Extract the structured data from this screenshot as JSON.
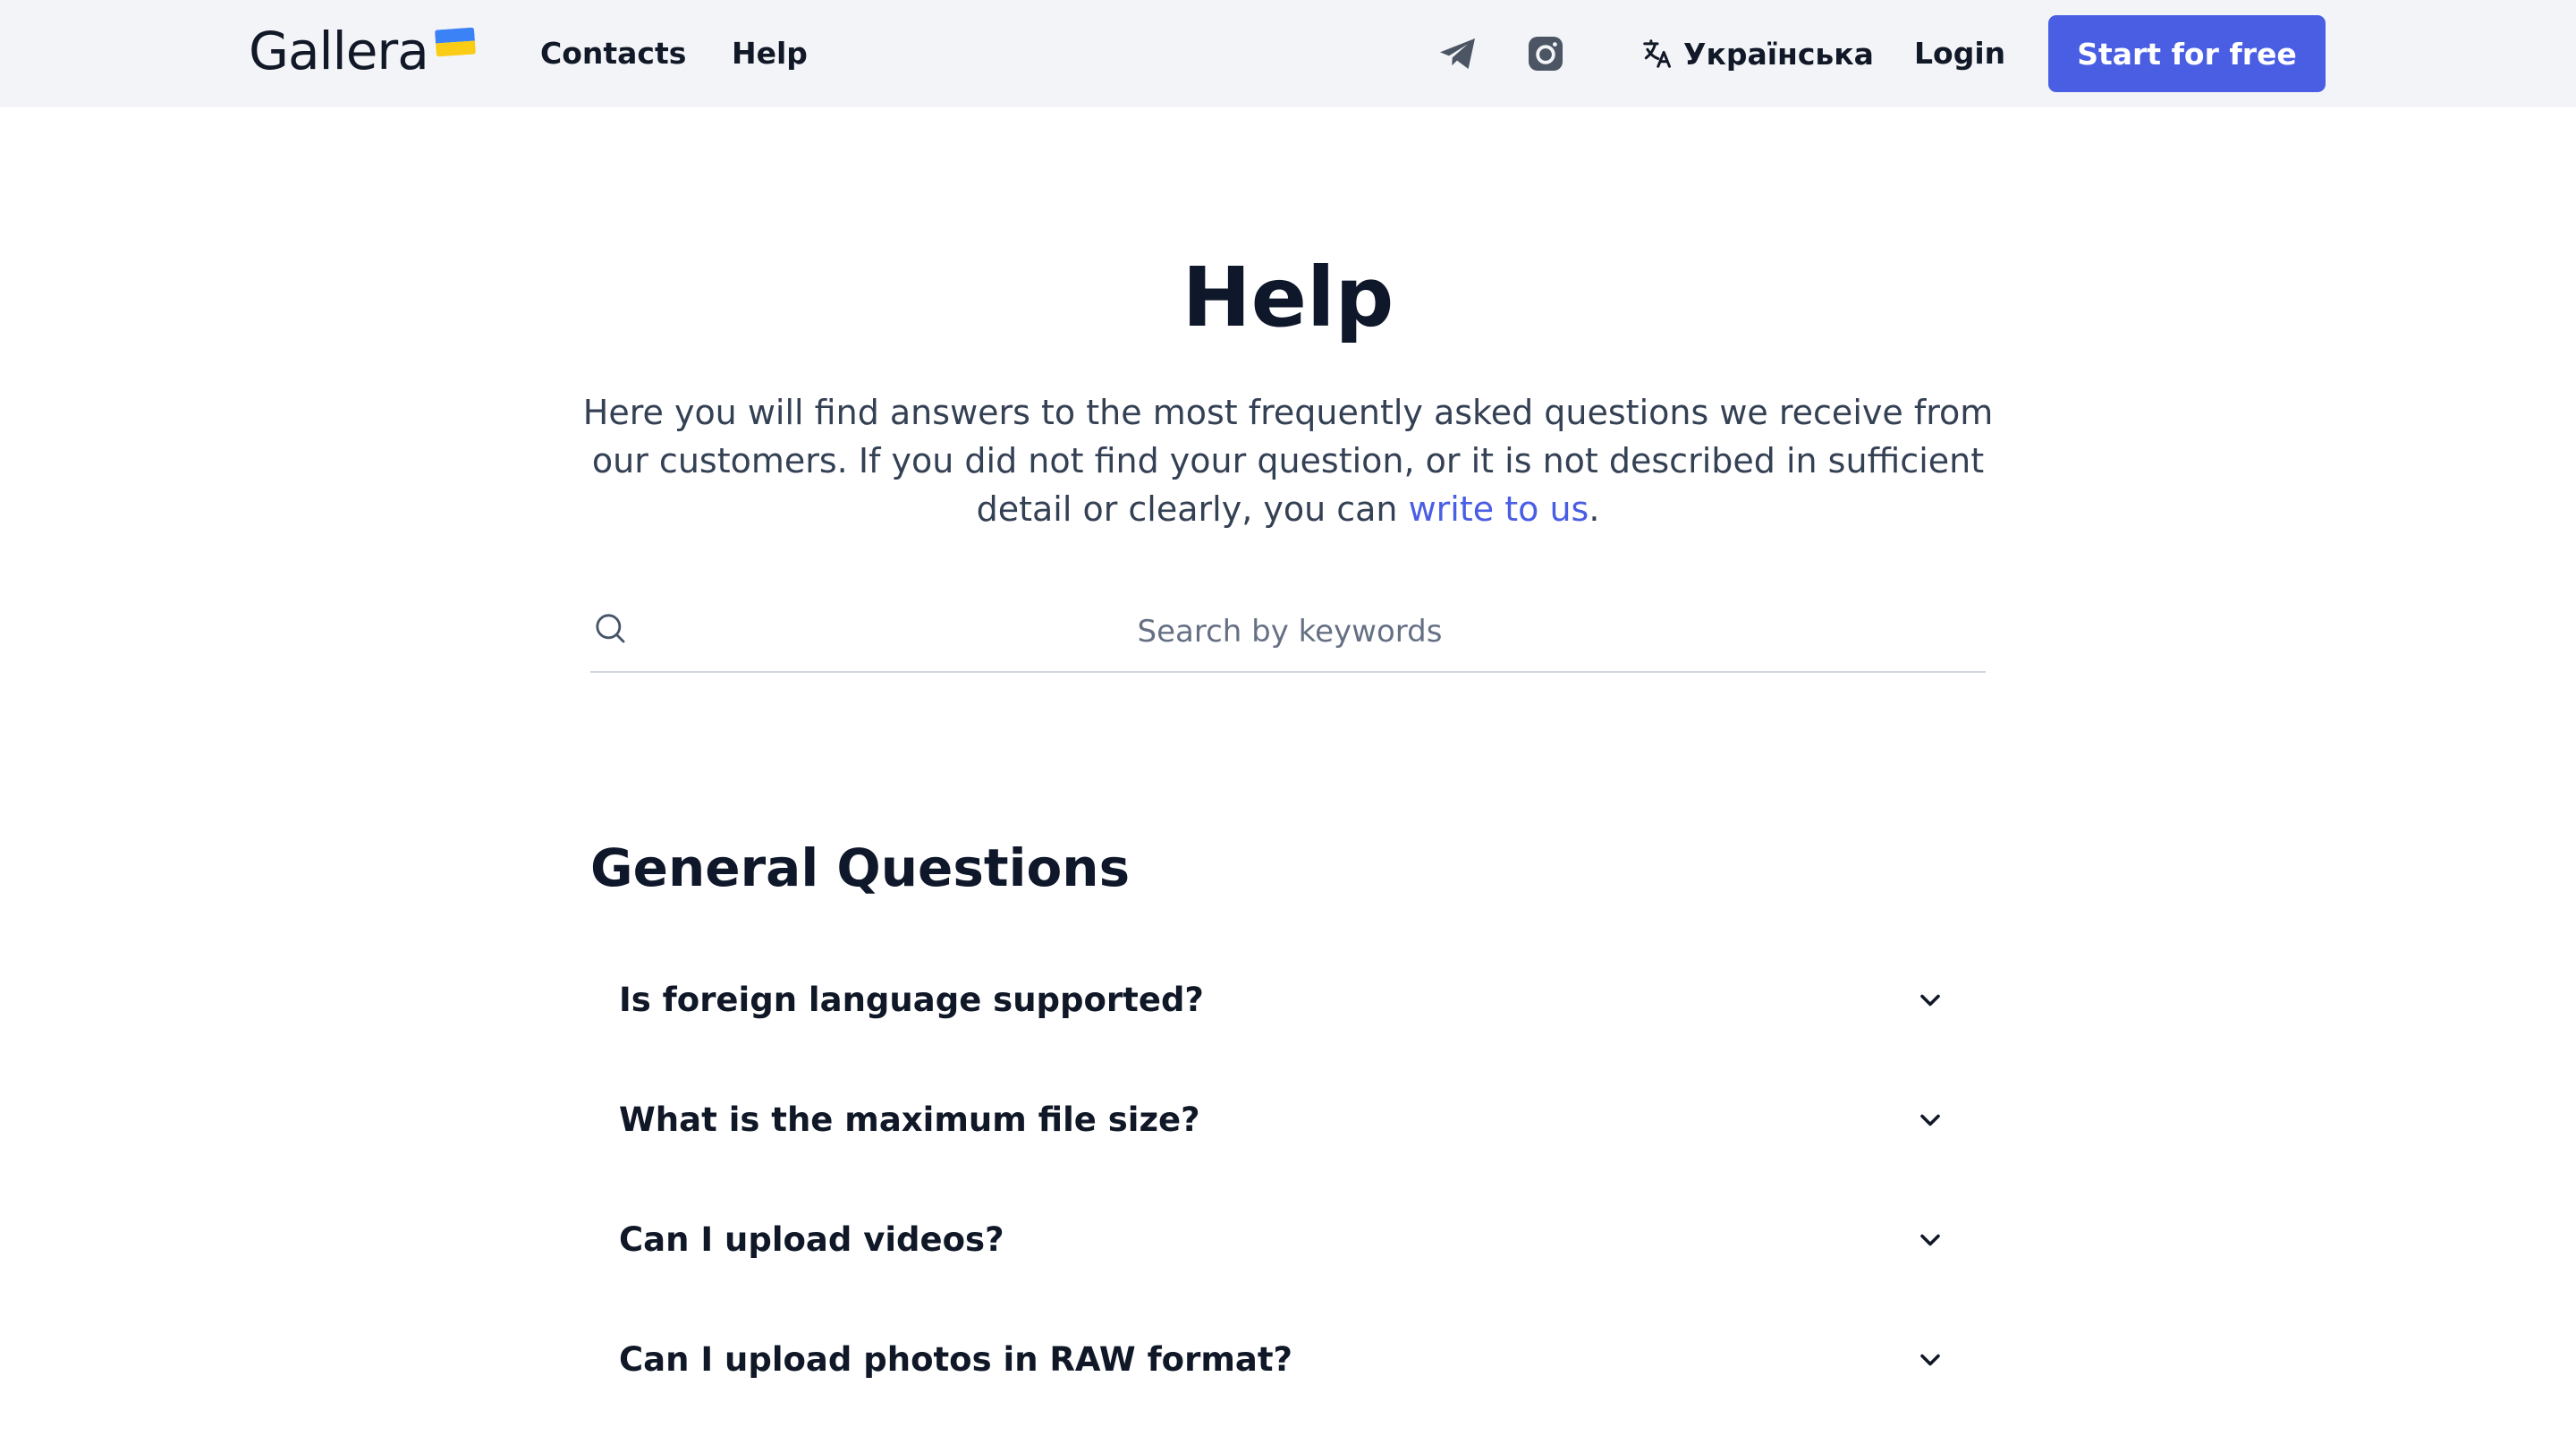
{
  "header": {
    "logo_text": "Gallera",
    "nav": {
      "contacts": "Contacts",
      "help": "Help"
    },
    "social": {
      "telegram_icon": "telegram-icon",
      "instagram_icon": "instagram-icon"
    },
    "language": {
      "icon": "translate-icon",
      "label": "Українська"
    },
    "login_label": "Login",
    "cta_label": "Start for free"
  },
  "main": {
    "title": "Help",
    "intro_text": "Here you will find answers to the most frequently asked questions we receive from our customers. If you did not find your question, or it is not described in sufficient detail or clearly, you can ",
    "intro_link": "write to us",
    "intro_end": ".",
    "search": {
      "placeholder": "Search by keywords",
      "value": ""
    },
    "section_title": "General Questions",
    "faq": [
      {
        "question": "Is foreign language supported?"
      },
      {
        "question": "What is the maximum file size?"
      },
      {
        "question": "Can I upload videos?"
      },
      {
        "question": "Can I upload photos in RAW format?"
      }
    ]
  },
  "colors": {
    "accent": "#4a5ee4",
    "header_bg": "#f3f4f7",
    "text_primary": "#0f172a",
    "text_secondary": "#344054"
  }
}
